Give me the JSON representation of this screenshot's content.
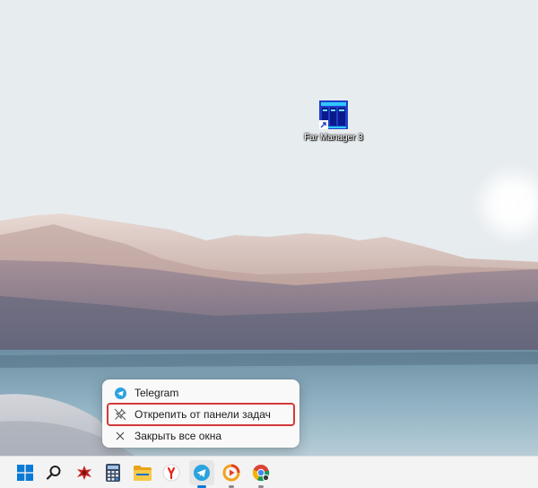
{
  "desktop": {
    "icon": {
      "name": "far-manager-icon",
      "label": "Far Manager 3"
    }
  },
  "context_menu": {
    "items": [
      {
        "label": "Telegram",
        "icon": "telegram-icon"
      },
      {
        "label": "Открепить от панели задач",
        "icon": "unpin-icon",
        "highlighted": true
      },
      {
        "label": "Закрыть все окна",
        "icon": "close-icon"
      }
    ],
    "highlight_color": "#d43a3a"
  },
  "taskbar": {
    "items": [
      {
        "name": "start-button",
        "icon": "windows-icon"
      },
      {
        "name": "search-button",
        "icon": "search-icon"
      },
      {
        "name": "app-red-button",
        "icon": "red-app-icon"
      },
      {
        "name": "calculator-button",
        "icon": "calculator-icon"
      },
      {
        "name": "file-explorer-button",
        "icon": "folder-icon"
      },
      {
        "name": "yandex-browser-button",
        "icon": "yandex-icon"
      },
      {
        "name": "telegram-button",
        "icon": "telegram-icon"
      },
      {
        "name": "media-app-button",
        "icon": "media-icon"
      },
      {
        "name": "chrome-button",
        "icon": "chrome-icon"
      }
    ]
  }
}
